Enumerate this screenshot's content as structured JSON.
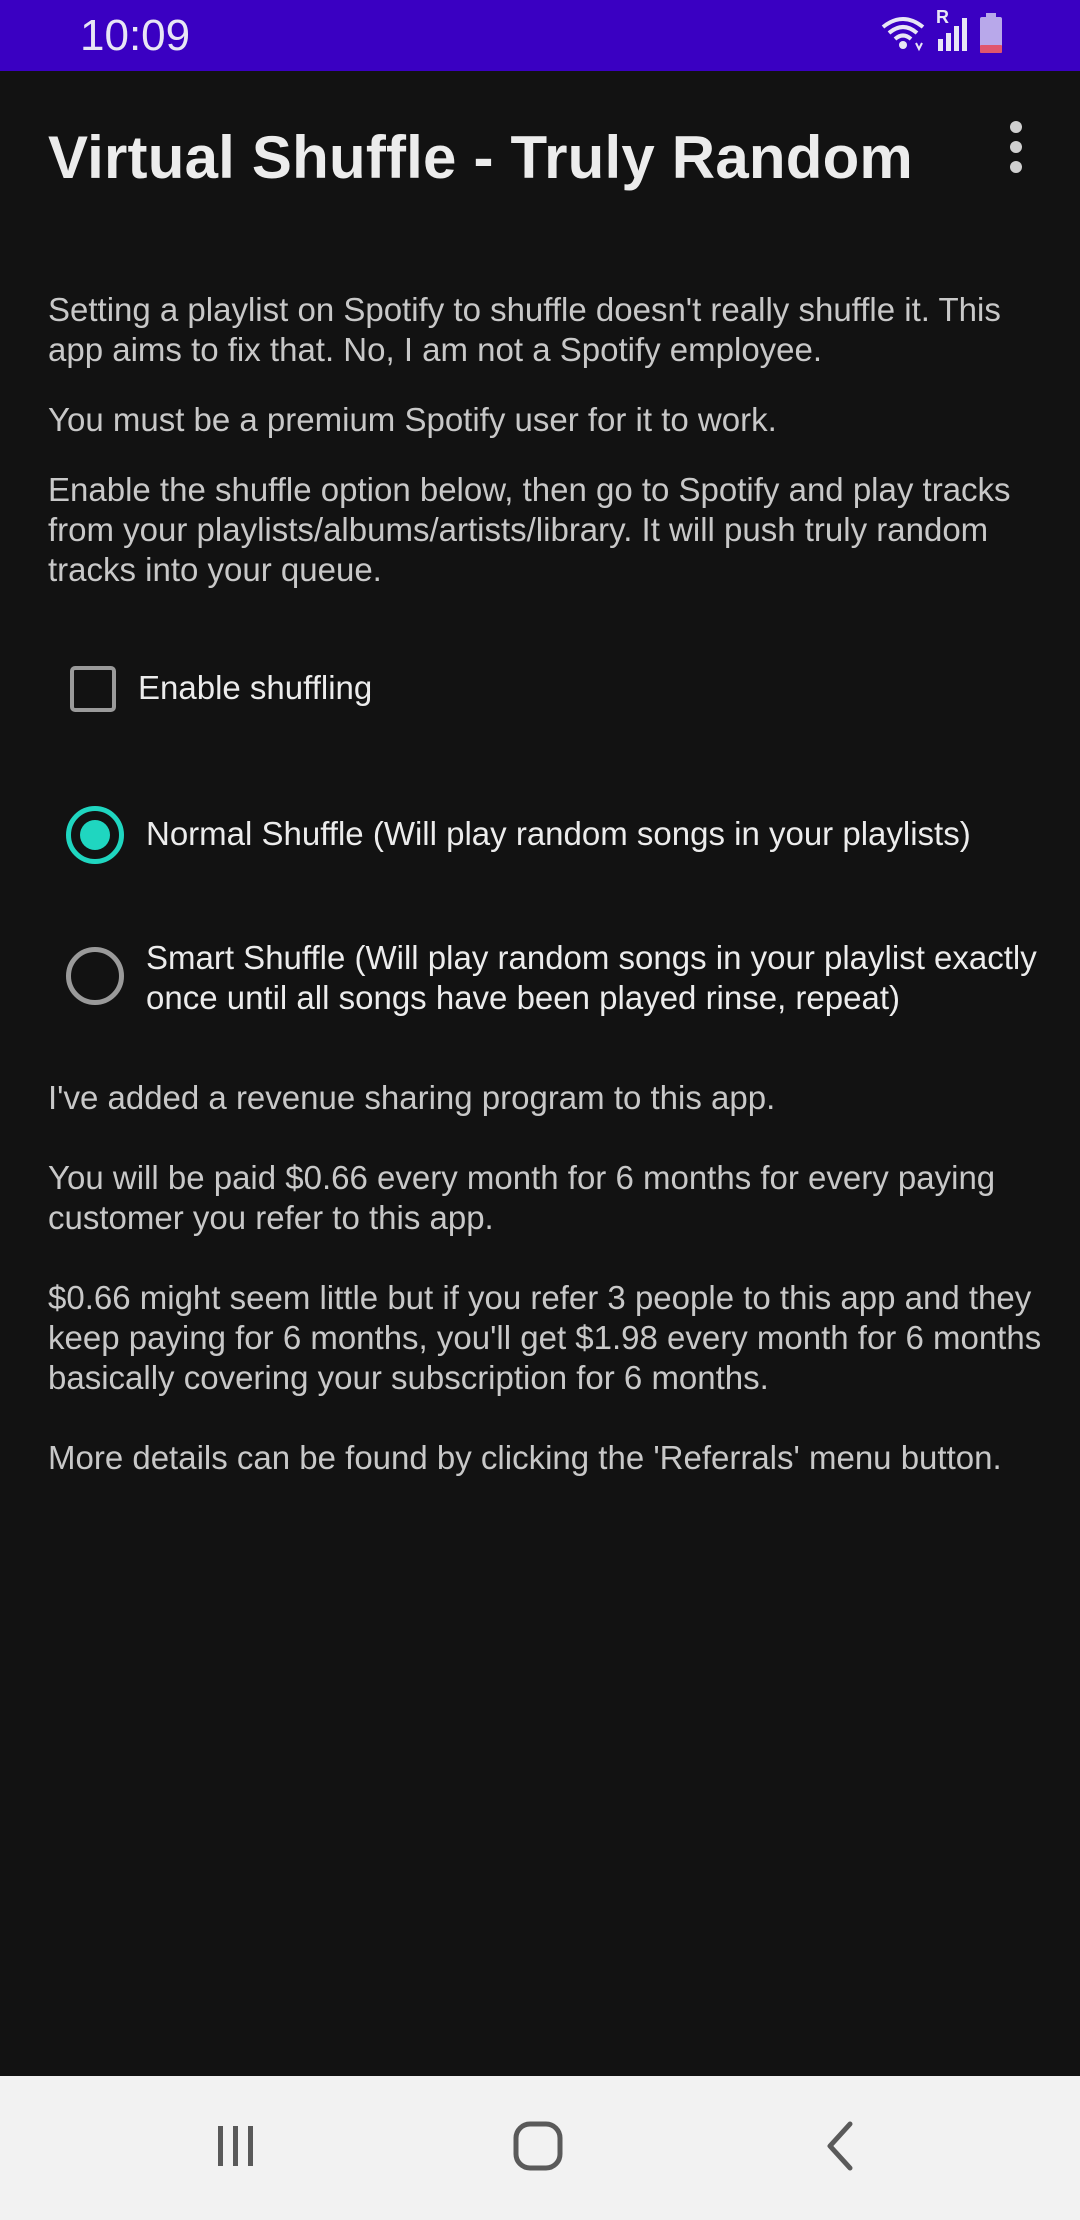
{
  "status_bar": {
    "time": "10:09",
    "icons": [
      "wifi-icon",
      "signal-icon",
      "battery-icon"
    ],
    "roaming_label": "R"
  },
  "app_bar": {
    "title": "Virtual Shuffle - Truly Random",
    "overflow_icon": "more-vert-icon"
  },
  "intro": {
    "p1": "Setting a playlist on Spotify to shuffle doesn't really shuffle it. This app aims to fix that. No, I am not a Spotify employee.",
    "p2": "You must be a premium Spotify user for it to work.",
    "p3": "Enable the shuffle option below, then go to Spotify and play tracks from your playlists/albums/artists/library. It will push truly random tracks into your queue."
  },
  "options": {
    "enable_shuffling": {
      "label": "Enable shuffling",
      "checked": false
    },
    "normal_shuffle": {
      "label": "Normal Shuffle (Will play random songs in your playlists)",
      "selected": true
    },
    "smart_shuffle": {
      "label": "Smart Shuffle (Will play random songs in your playlist exactly once until all songs have been played rinse, repeat)",
      "selected": false
    }
  },
  "referral": {
    "p1": "I've added a revenue sharing program to this app.",
    "p2": "You will be paid $0.66 every month for 6 months for every paying customer you refer to this app.",
    "p3": "$0.66 might seem little but if you refer 3 people to this app and they keep paying for 6 months, you'll get $1.98 every month for 6 months basically covering your subscription for 6 months.",
    "p4": "More details can be found by clicking the 'Referrals' menu button."
  },
  "nav_bar": {
    "buttons": [
      "recent-apps-icon",
      "home-icon",
      "back-icon"
    ]
  },
  "colors": {
    "status_bar": "#3a00c2",
    "background": "#121212",
    "accent": "#1fd6c0",
    "nav_bar": "#f2f2f2"
  }
}
